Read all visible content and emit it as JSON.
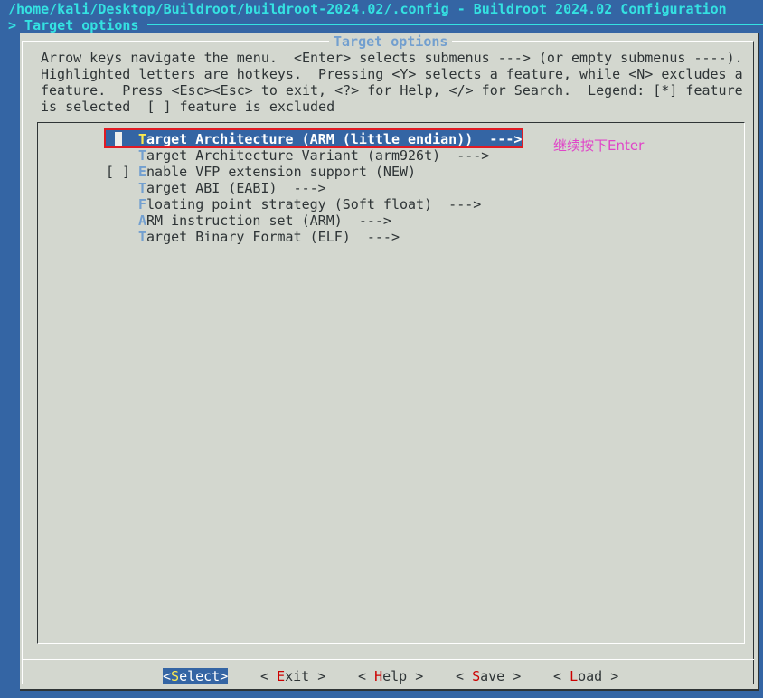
{
  "window": {
    "title": "/home/kali/Desktop/Buildroot/buildroot-2024.02/.config - Buildroot 2024.02 Configuration",
    "breadcrumb": "> Target options"
  },
  "dialog": {
    "title": "Target options",
    "help_lines": [
      "Arrow keys navigate the menu.  <Enter> selects submenus ---> (or empty submenus ----).",
      "Highlighted letters are hotkeys.  Pressing <Y> selects a feature, while <N> excludes a",
      "feature.  Press <Esc><Esc> to exit, <?> for Help, </> for Search.  Legend: [*] feature",
      "is selected  [ ] feature is excluded"
    ]
  },
  "menu": {
    "items": [
      {
        "hotkey": "T",
        "rest": "arget Architecture (ARM (little endian))  --->",
        "selected": true,
        "checkbox": ""
      },
      {
        "hotkey": "T",
        "rest": "arget Architecture Variant (arm926t)  --->",
        "checkbox": ""
      },
      {
        "hotkey": "E",
        "rest": "nable VFP extension support (NEW)",
        "checkbox": "[ ]"
      },
      {
        "hotkey": "T",
        "rest": "arget ABI (EABI)  --->",
        "checkbox": ""
      },
      {
        "hotkey": "F",
        "rest": "loating point strategy (Soft float)  --->",
        "checkbox": ""
      },
      {
        "hotkey": "A",
        "rest": "RM instruction set (ARM)  --->",
        "checkbox": ""
      },
      {
        "hotkey": "T",
        "rest": "arget Binary Format (ELF)  --->",
        "checkbox": ""
      }
    ]
  },
  "buttons": [
    {
      "pre": "<",
      "hotkey": "S",
      "rest": "elect>",
      "selected": true
    },
    {
      "pre": "< ",
      "hotkey": "E",
      "rest": "xit >"
    },
    {
      "pre": "< ",
      "hotkey": "H",
      "rest": "elp >"
    },
    {
      "pre": "< ",
      "hotkey": "S",
      "rest": "ave >"
    },
    {
      "pre": "< ",
      "hotkey": "L",
      "rest": "oad >"
    }
  ],
  "annotation": "继续按下Enter",
  "colors": {
    "background": "#3465a4",
    "dialog": "#d3d7cf",
    "title": "#34e2e2",
    "highlight_box": "#e01b24",
    "annotation": "#e044c8"
  }
}
